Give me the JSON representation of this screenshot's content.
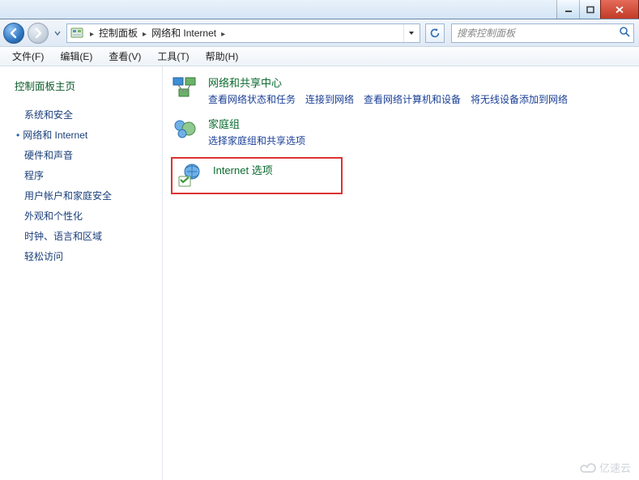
{
  "breadcrumb": {
    "root_sep": "▸",
    "cp": "控制面板",
    "current": "网络和 Internet"
  },
  "search": {
    "placeholder": "搜索控制面板"
  },
  "menu": {
    "file": "文件(F)",
    "edit": "编辑(E)",
    "view": "查看(V)",
    "tools": "工具(T)",
    "help": "帮助(H)"
  },
  "sidebar": {
    "home": "控制面板主页",
    "items": [
      "系统和安全",
      "网络和 Internet",
      "硬件和声音",
      "程序",
      "用户帐户和家庭安全",
      "外观和个性化",
      "时钟、语言和区域",
      "轻松访问"
    ],
    "current_index": 1
  },
  "content": {
    "categories": [
      {
        "title": "网络和共享中心",
        "links": [
          "查看网络状态和任务",
          "连接到网络",
          "查看网络计算机和设备",
          "将无线设备添加到网络"
        ]
      },
      {
        "title": "家庭组",
        "links": [
          "选择家庭组和共享选项"
        ]
      },
      {
        "title": "Internet 选项",
        "links": [],
        "highlight": true
      }
    ]
  },
  "watermark": "亿速云"
}
